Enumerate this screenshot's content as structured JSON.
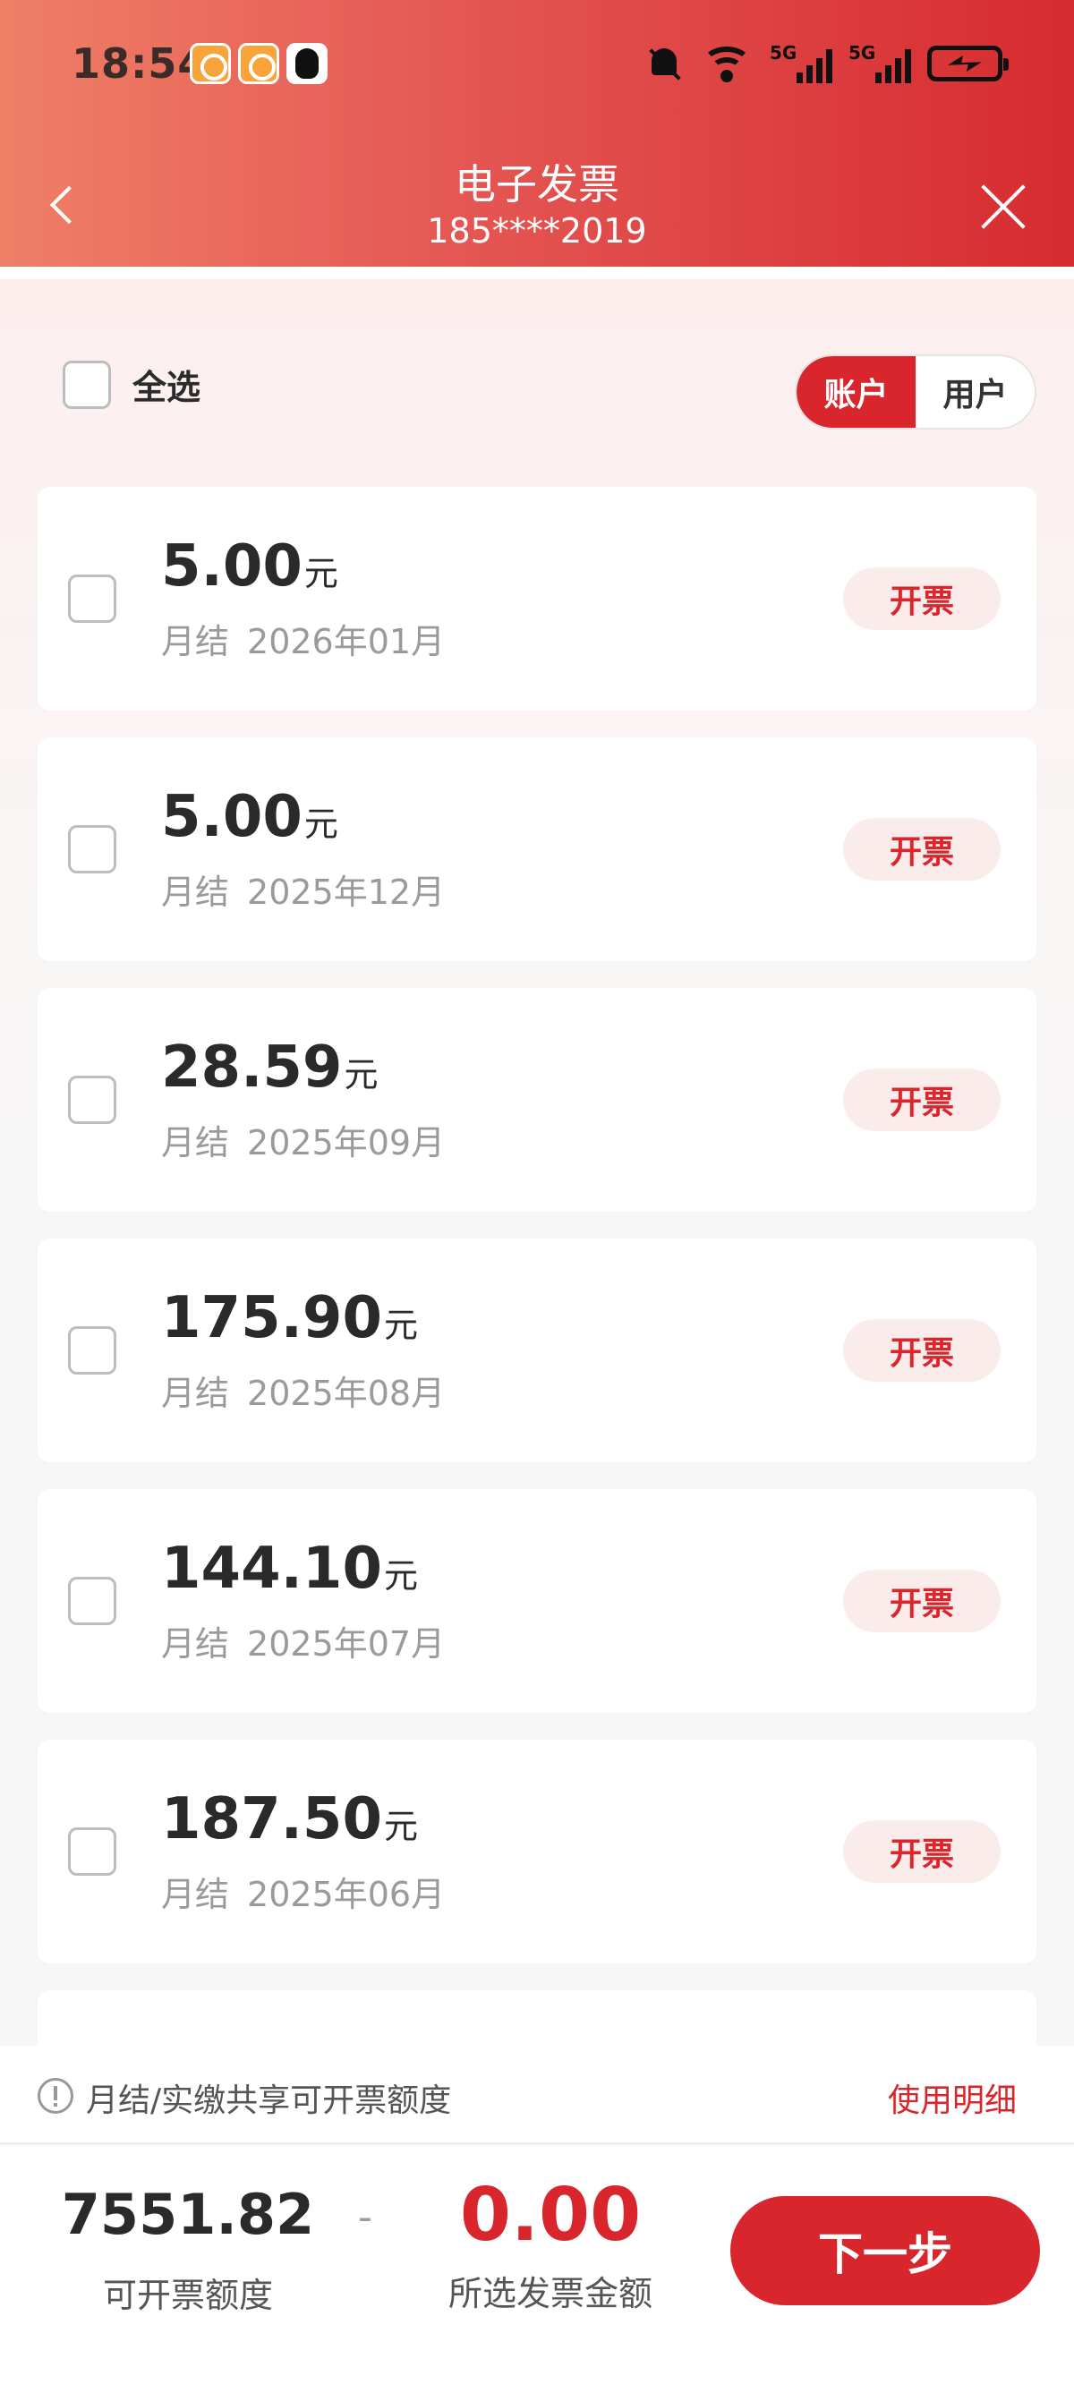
{
  "status_bar": {
    "time": "18:54",
    "network_1": "5G",
    "network_2": "5G"
  },
  "nav": {
    "title": "电子发票",
    "subtitle": "185****2019"
  },
  "toolbar": {
    "select_all_label": "全选",
    "segments": [
      "账户",
      "用户"
    ],
    "active_segment": "账户"
  },
  "invoices": [
    {
      "amount": "5.00",
      "unit": "元",
      "type": "月结",
      "period": "2026年01月",
      "action": "开票"
    },
    {
      "amount": "5.00",
      "unit": "元",
      "type": "月结",
      "period": "2025年12月",
      "action": "开票"
    },
    {
      "amount": "28.59",
      "unit": "元",
      "type": "月结",
      "period": "2025年09月",
      "action": "开票"
    },
    {
      "amount": "175.90",
      "unit": "元",
      "type": "月结",
      "period": "2025年08月",
      "action": "开票"
    },
    {
      "amount": "144.10",
      "unit": "元",
      "type": "月结",
      "period": "2025年07月",
      "action": "开票"
    },
    {
      "amount": "187.50",
      "unit": "元",
      "type": "月结",
      "period": "2025年06月",
      "action": "开票"
    }
  ],
  "notice": {
    "text": "月结/实缴共享可开票额度",
    "link": "使用明细"
  },
  "footer": {
    "quota_value": "7551.82",
    "quota_label": "可开票额度",
    "separator": "-",
    "selected_value": "0.00",
    "selected_label": "所选发票金额",
    "next_button": "下一步"
  },
  "colors": {
    "accent": "#d8262c",
    "header_start": "#ef7f67",
    "header_end": "#d62b2f"
  }
}
